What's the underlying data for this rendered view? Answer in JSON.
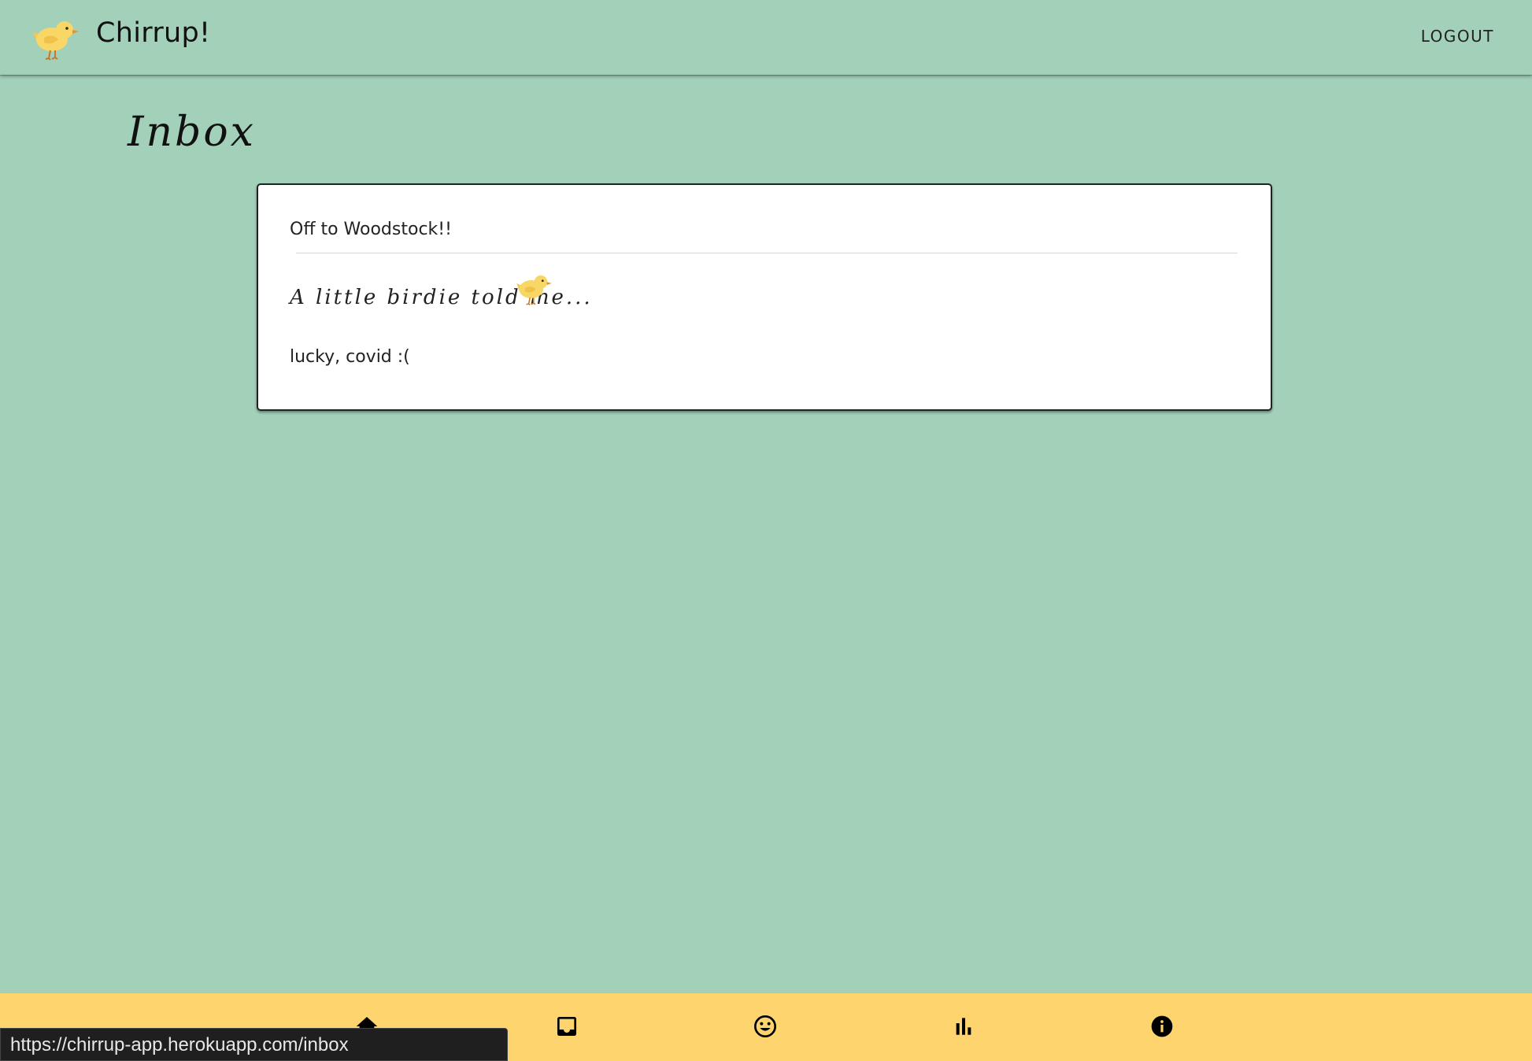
{
  "app": {
    "name": "Chirrup!",
    "logo_icon": "chick-icon"
  },
  "header": {
    "logout_label": "LOGOUT"
  },
  "page": {
    "title": "Inbox"
  },
  "message": {
    "subject": "Off to Woodstock!!",
    "greeting": "A little birdie told me...",
    "body": "lucky, covid :("
  },
  "bottom_nav": {
    "items": [
      {
        "icon": "home-icon"
      },
      {
        "icon": "inbox-icon"
      },
      {
        "icon": "smiley-icon"
      },
      {
        "icon": "bar-chart-icon"
      },
      {
        "icon": "info-icon"
      }
    ]
  },
  "status_bar": {
    "url": "https://chirrup-app.herokuapp.com/inbox"
  },
  "colors": {
    "background": "#a2d0b9",
    "bottom_nav": "#fdd46e",
    "card": "#ffffff"
  }
}
